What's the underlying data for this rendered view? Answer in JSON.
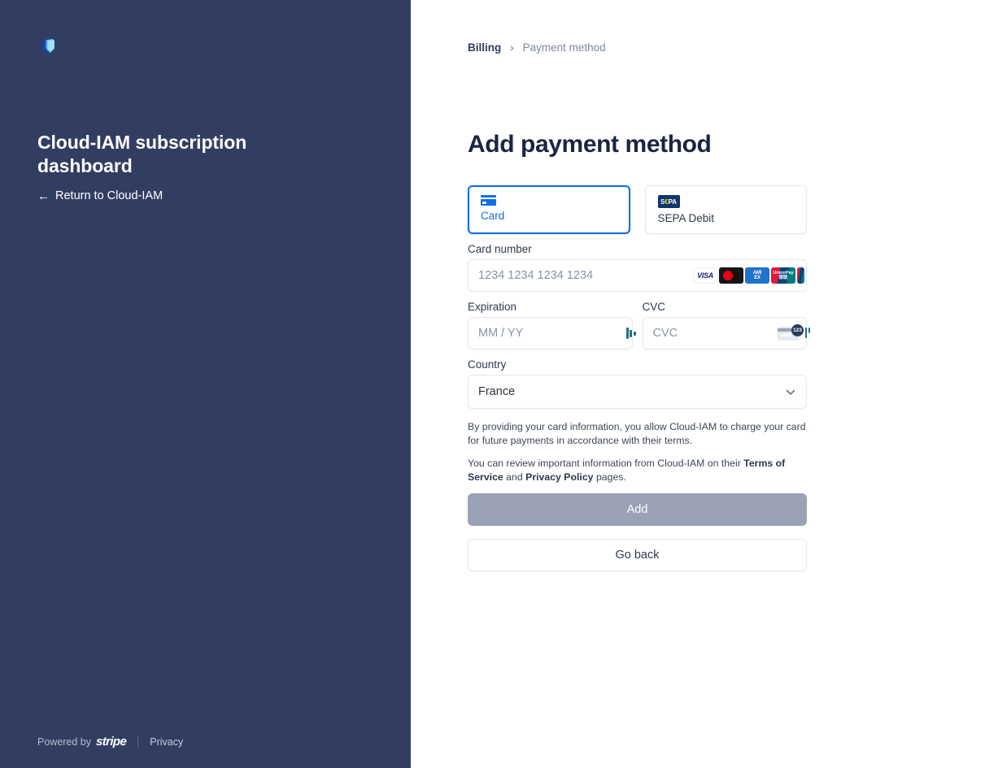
{
  "sidebar": {
    "logo_icon": "shield-logo-icon",
    "title": "Cloud-IAM subscription dashboard",
    "return_link": {
      "arrow": "←",
      "label": "Return to Cloud-IAM"
    },
    "footer": {
      "powered_by": "Powered by",
      "stripe": "stripe",
      "privacy": "Privacy"
    },
    "colors": {
      "background": "#313e62",
      "title": "#ffffff"
    }
  },
  "breadcrumb": {
    "parent": "Billing",
    "separator": "›",
    "current": "Payment method"
  },
  "header": {
    "title": "Add payment method"
  },
  "payment_methods": [
    {
      "id": "card",
      "label": "Card",
      "icon": "credit-card-icon",
      "selected": true
    },
    {
      "id": "sepa_debit",
      "label": "SEPA Debit",
      "icon": "sepa-logo-icon",
      "selected": false
    }
  ],
  "form": {
    "card_number": {
      "label": "Card number",
      "placeholder": "1234 1234 1234 1234",
      "value": "",
      "brands": [
        "VISA",
        "Mastercard",
        "AMEX",
        "UnionPay"
      ]
    },
    "expiration": {
      "label": "Expiration",
      "placeholder": "MM / YY",
      "value": "",
      "icon": "expiration-hint-icon"
    },
    "cvc": {
      "label": "CVC",
      "placeholder": "CVC",
      "value": "",
      "icon": "cvc-card-back-icon",
      "badge_text": "123"
    },
    "country": {
      "label": "Country",
      "value": "France",
      "icon": "chevron-down-icon",
      "options": [
        "France"
      ]
    }
  },
  "legal": {
    "paragraph_1": "By providing your card information, you allow Cloud-IAM to charge your card for future payments in accordance with their terms.",
    "paragraph_2_prefix": "You can review important information from Cloud-IAM on their ",
    "terms_link": "Terms of Service",
    "paragraph_2_middle": " and ",
    "privacy_link": "Privacy Policy",
    "paragraph_2_suffix": " pages."
  },
  "actions": {
    "submit_label": "Add",
    "submit_disabled": true,
    "back_label": "Go back"
  },
  "colors": {
    "accent_blue": "#0c6ee8",
    "sidebar_navy": "#313e62",
    "disabled_button": "#9ba2b5",
    "title_navy": "#1a2544",
    "border_gray": "#e4e8ee"
  }
}
